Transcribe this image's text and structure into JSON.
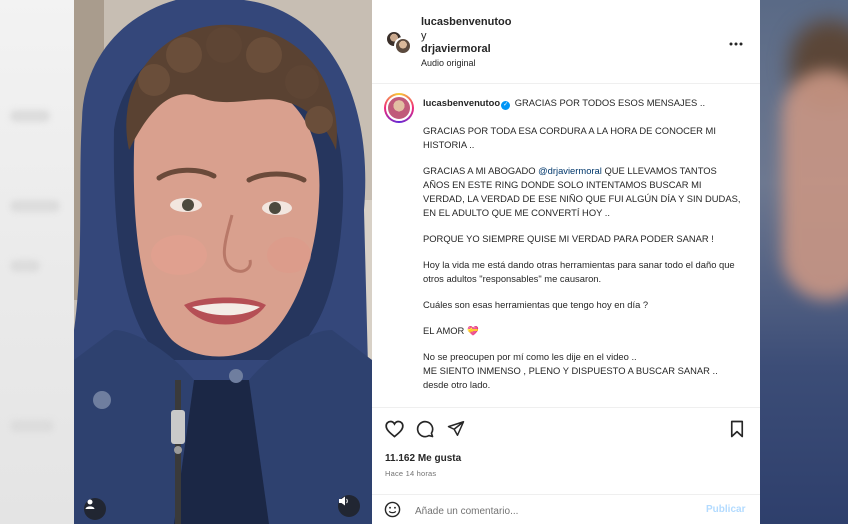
{
  "post": {
    "header": {
      "user_primary": "lucasbenvenutoo",
      "connector": "y",
      "user_secondary": "drjaviermoral",
      "audio": "Audio original",
      "more_icon": "more-horizontal-icon"
    },
    "caption": {
      "username": "lucasbenvenutoo",
      "verified_icon": "verified-badge-icon",
      "line1": "GRACIAS POR TODOS ESOS MENSAJES ..",
      "p2": "GRACIAS POR TODA ESA CORDURA A LA HORA DE CONOCER MI HISTORIA ..",
      "p3_before": "GRACIAS A MI ABOGADO ",
      "p3_mention": "@drjaviermoral",
      "p3_after": " QUE LLEVAMOS TANTOS AÑOS EN ESTE RING DONDE SOLO INTENTAMOS BUSCAR MI VERDAD, LA VERDAD DE ESE NIÑO QUE FUI ALGÚN DÍA Y SIN DUDAS, EN EL ADULTO QUE ME CONVERTÍ HOY ..",
      "p4": "PORQUE YO SIEMPRE QUISE MI VERDAD PARA PODER SANAR !",
      "p5": "Hoy la vida me está dando otras herramientas para sanar todo el daño que otros adultos \"responsables\" me causaron.",
      "p6": "Cuáles son esas herramientas que tengo hoy en día ?",
      "p7": "EL AMOR",
      "p7_emoji": "💝",
      "p8_line1": "No se preocupen por mí como les dije en el video ..",
      "p8_line2": "ME SIENTO INMENSO , PLENO Y DISPUESTO A BUSCAR SANAR ..",
      "p8_line3": "desde otro lado."
    },
    "actions": {
      "like_icon": "heart-icon",
      "comment_icon": "comment-icon",
      "share_icon": "send-icon",
      "save_icon": "bookmark-icon",
      "likes": "11.162 Me gusta",
      "time": "Hace 14 horas"
    },
    "comment_box": {
      "emoji_icon": "emoji-icon",
      "placeholder": "Añade un comentario...",
      "publish_label": "Publicar"
    }
  },
  "media": {
    "user_tag_icon": "user-tag-icon",
    "audio_icon": "speaker-icon"
  },
  "colors": {
    "accent": "#0095f6",
    "mention": "#00376b",
    "publish_disabled": "#b3dbff",
    "hood_blue": "#34477a"
  }
}
